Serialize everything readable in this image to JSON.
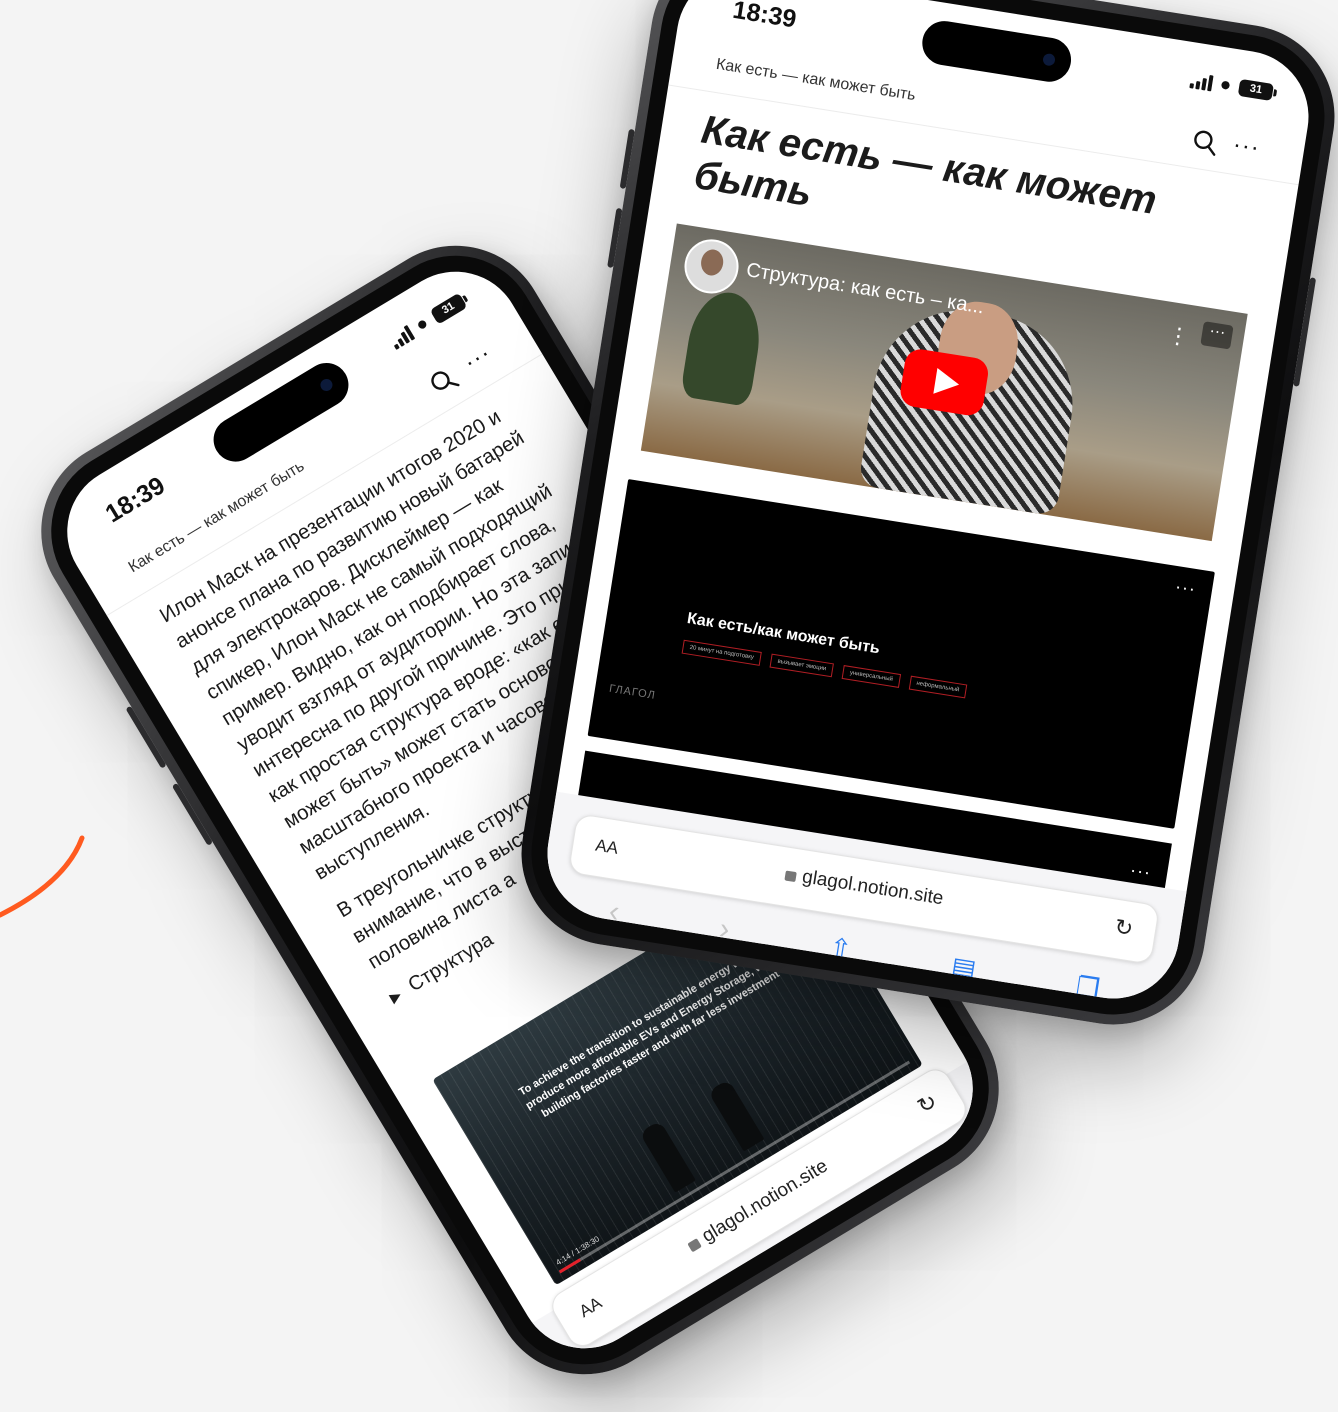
{
  "colors": {
    "accent": "#2a7cf0",
    "youtube_red": "#ff0000",
    "swoosh": "#ff5a1f"
  },
  "phone_left": {
    "status": {
      "time": "18:39",
      "battery": "31"
    },
    "nav": {
      "breadcrumb": "Как есть — как может быть"
    },
    "article": {
      "paragraph_1": "Илон Маск на презентации итогов 2020 и анонсе плана по развитию новый батарей для электрокаров. Дисклеймер — как спикер, Илон Маск не самый подходящий пример. Видно, как он подбирает слова, уводит взгляд от аудитории. Но эта запись интересна по другой причине. Это пример, как простая структура вроде: «как есть/как может быть» может стать основой масштабного проекта и часового выступления.",
      "paragraph_2": "В треугольничке структура вы Обратите внимание, что в выступление помеща половина листа а",
      "toggle_label": "Структура"
    },
    "video": {
      "caption": "To achieve the transition to sustainable energy we must produce more affordable EVs and Energy Storage, while building factories faster and with far less investment",
      "timestamp": "4:14 / 1:38:30"
    },
    "safari": {
      "aa": "AA",
      "url": "glagol.notion.site"
    }
  },
  "phone_right": {
    "status": {
      "time": "18:39",
      "battery": "31"
    },
    "nav": {
      "breadcrumb": "Как есть — как может быть"
    },
    "page_title": "Как есть — как может быть",
    "youtube": {
      "title": "Структура: как есть – ка...",
      "menu_dots": "···"
    },
    "slides": {
      "title": "Как есть/как может быть",
      "tags": [
        "20 минут на подготовку",
        "вызывает эмоции",
        "универсальный",
        "неформальный"
      ],
      "logo": "ГЛАГОЛ"
    },
    "safari": {
      "aa": "AA",
      "url": "glagol.notion.site"
    }
  }
}
